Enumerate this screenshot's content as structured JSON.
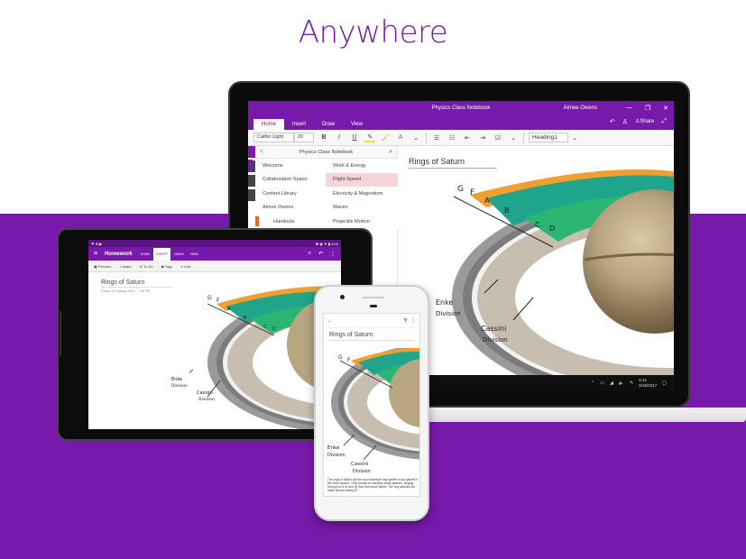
{
  "headline": "Anywhere",
  "colors": {
    "brand_purple": "#7719aa",
    "selected_page": "#f4d6da",
    "section_orange": "#e9661f"
  },
  "laptop": {
    "window_title": "Physics Class Notebook",
    "user": "Aimee Owens",
    "window_controls": [
      "—",
      "❐",
      "✕"
    ],
    "tabs": [
      {
        "label": "Home",
        "active": true
      },
      {
        "label": "Insert",
        "active": false
      },
      {
        "label": "Draw",
        "active": false
      },
      {
        "label": "View",
        "active": false
      }
    ],
    "tabs_right": {
      "undo": "↶",
      "account": "♙",
      "share_label": "Share",
      "expand": "⤢"
    },
    "toolbar": {
      "font_name": "Calibri Light",
      "font_size": "20",
      "bold": "B",
      "italic": "I",
      "underline": "U",
      "highlight": "✎",
      "format_painter": "🖌",
      "clear_format": "A",
      "dropdown": "⌄",
      "bullets": "☰",
      "numbering": "☷",
      "outdent": "⇤",
      "indent": "⇥",
      "todo": "☑",
      "style_value": "Heading1"
    },
    "nav": {
      "notebook_name": "Physics Class Notebook",
      "back": "<",
      "search": "⌕",
      "sections": [
        {
          "label": "Welcome",
          "active": true,
          "sub": false
        },
        {
          "label": "Collaboration Space",
          "active": false,
          "sub": false
        },
        {
          "label": "Content Library",
          "active": false,
          "sub": false
        },
        {
          "label": "Aimee Owens",
          "active": false,
          "sub": false
        },
        {
          "label": "Handouts",
          "active": false,
          "sub": true
        }
      ],
      "pages": [
        {
          "label": "Work & Energy",
          "selected": false
        },
        {
          "label": "Flight-Speed",
          "selected": true
        },
        {
          "label": "Elecricity & Magnetism",
          "selected": false
        },
        {
          "label": "Waves",
          "selected": false
        },
        {
          "label": "Projectile Motion",
          "selected": false
        }
      ]
    },
    "page_title": "Rings of Saturn",
    "annotations": {
      "ring_labels": [
        "G",
        "F",
        "A",
        "B",
        "C",
        "D"
      ],
      "encke": [
        "Enke",
        "Division"
      ],
      "cassini": [
        "Cassini",
        "Division"
      ]
    },
    "taskbar": {
      "time": "5:41",
      "date": "8/18/2017"
    }
  },
  "tablet": {
    "status_bar_time": "3:33",
    "app_title": "Homework",
    "tabs": [
      {
        "label": "HOME",
        "active": false
      },
      {
        "label": "INSERT",
        "active": true
      },
      {
        "label": "DRAW",
        "active": false
      },
      {
        "label": "VIEW",
        "active": false
      }
    ],
    "toolbar": [
      {
        "icon": "camera-icon",
        "glyph": "📷",
        "label": "Pictures"
      },
      {
        "icon": "mic-icon",
        "glyph": "🎙",
        "label": "Audio"
      },
      {
        "icon": "checkbox-icon",
        "glyph": "☑",
        "label": "To Do"
      },
      {
        "icon": "tag-icon",
        "glyph": "🏷",
        "label": "Tags"
      },
      {
        "icon": "link-icon",
        "glyph": "🔗",
        "label": "Link"
      }
    ],
    "page_title": "Rings of Saturn",
    "page_date": "Friday, 25 January 2019",
    "page_time": "7:38 PM"
  },
  "phone": {
    "back": "←",
    "filter": "∀",
    "more": "⋮",
    "page_title": "Rings of Saturn",
    "body_text": "The rings of Saturn are the most extensive ring system of any planet in the Solar System. They consist of countless small particles, ranging from μm to m in size,[1] that orbit about Saturn. The ring particles are made almost entirely of"
  }
}
